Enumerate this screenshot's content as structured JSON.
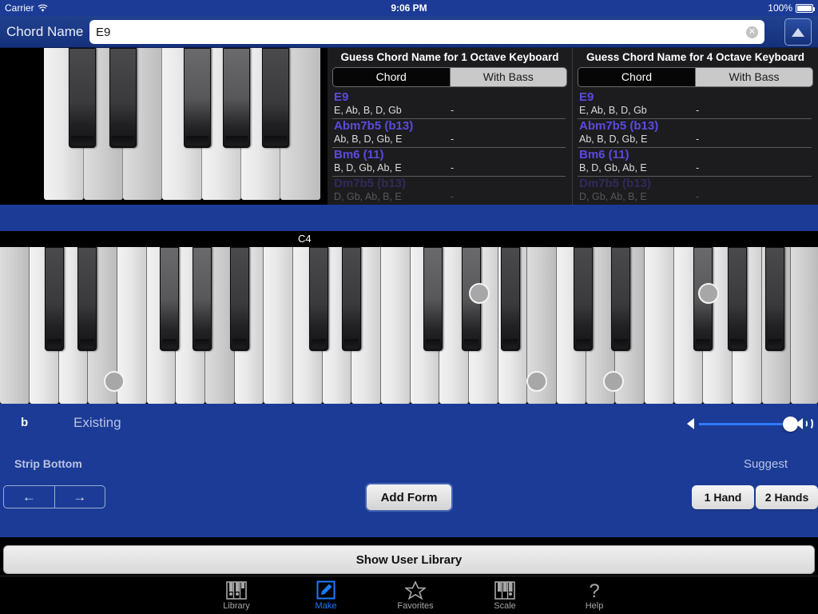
{
  "status_bar": {
    "carrier": "Carrier",
    "wifi_icon": "wifi-icon",
    "time": "9:06 PM",
    "battery_pct": "100%"
  },
  "nav": {
    "label": "Chord Name",
    "value": "E9",
    "placeholder": "",
    "clear_icon": "clear-circle-icon",
    "up_button_icon": "triangle-up-icon"
  },
  "mini_keyboard": {
    "close_icon": "close-circle-icon"
  },
  "guess_panels": [
    {
      "title": "Guess Chord Name for 1 Octave Keyboard",
      "segments": [
        {
          "label": "Chord",
          "selected": true
        },
        {
          "label": "With Bass",
          "selected": false
        }
      ],
      "rows": [
        {
          "name": "E9",
          "notes": "E, Ab, B, D, Gb",
          "dash": "-"
        },
        {
          "name": "Abm7b5 (b13)",
          "notes": "Ab, B, D, Gb, E",
          "dash": "-"
        },
        {
          "name": "Bm6 (11)",
          "notes": "B, D, Gb, Ab, E",
          "dash": "-"
        },
        {
          "name": "Dm7b5 (b13)",
          "notes": "D, Gb, Ab, B, E",
          "dash": "-"
        }
      ]
    },
    {
      "title": "Guess Chord Name for 4 Octave Keyboard",
      "segments": [
        {
          "label": "Chord",
          "selected": true
        },
        {
          "label": "With Bass",
          "selected": false
        }
      ],
      "rows": [
        {
          "name": "E9",
          "notes": "E, Ab, B, D, Gb",
          "dash": "-"
        },
        {
          "name": "Abm7b5 (b13)",
          "notes": "Ab, B, D, Gb, E",
          "dash": "-"
        },
        {
          "name": "Bm6 (11)",
          "notes": "B, D, Gb, Ab, E",
          "dash": "-"
        },
        {
          "name": "Dm7b5 (b13)",
          "notes": "D, Gb, Ab, B, E",
          "dash": "-"
        }
      ]
    }
  ],
  "main_keyboard": {
    "octave_marker": "C4"
  },
  "controls": {
    "flat_symbol": "b",
    "mode_label": "Existing",
    "volume": {
      "low_icon": "speaker-low-icon",
      "high_icon": "speaker-high-icon",
      "level_pct": 100
    },
    "strip_bottom_label": "Strip Bottom",
    "arrow_left_icon": "arrow-left-icon",
    "arrow_right_icon": "arrow-right-icon",
    "add_form_label": "Add Form",
    "suggest_label": "Suggest",
    "suggest_one_hand": "1 Hand",
    "suggest_two_hands": "2 Hands"
  },
  "user_library_button": "Show User Library",
  "tab_bar": [
    {
      "label": "Library",
      "icon": "piano-keys-icon",
      "active": false
    },
    {
      "label": "Make",
      "icon": "pencil-square-icon",
      "active": true
    },
    {
      "label": "Favorites",
      "icon": "star-icon",
      "active": false
    },
    {
      "label": "Scale",
      "icon": "piano-keys-icon",
      "active": false
    },
    {
      "label": "Help",
      "icon": "question-mark-icon",
      "active": false
    }
  ],
  "colors": {
    "brand_blue": "#1b3b96",
    "accent_purple": "#5b4ae0",
    "tab_active": "#1e7bff"
  }
}
